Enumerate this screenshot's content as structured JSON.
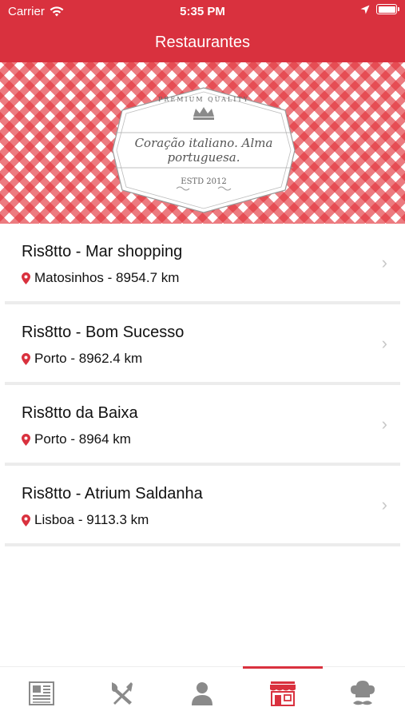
{
  "status": {
    "carrier": "Carrier",
    "time": "5:35 PM"
  },
  "nav": {
    "title": "Restaurantes"
  },
  "banner": {
    "quality": "PREMIUM QUALITY",
    "tagline": "Coração italiano. Alma portuguesa.",
    "estd": "ESTD 2012"
  },
  "restaurants": [
    {
      "name": "Ris8tto - Mar shopping",
      "location": "Matosinhos - 8954.7 km"
    },
    {
      "name": "Ris8tto - Bom Sucesso",
      "location": "Porto - 8962.4 km"
    },
    {
      "name": "Ris8tto da Baixa",
      "location": "Porto - 8964 km"
    },
    {
      "name": "Ris8tto - Atrium Saldanha",
      "location": "Lisboa - 9113.3 km"
    }
  ],
  "tabs": [
    {
      "icon": "newspaper-icon"
    },
    {
      "icon": "fork-knife-icon"
    },
    {
      "icon": "person-icon"
    },
    {
      "icon": "store-icon",
      "active": true
    },
    {
      "icon": "chef-icon"
    }
  ],
  "colors": {
    "brand": "#d9313e",
    "icon_gray": "#8a8a8a"
  }
}
